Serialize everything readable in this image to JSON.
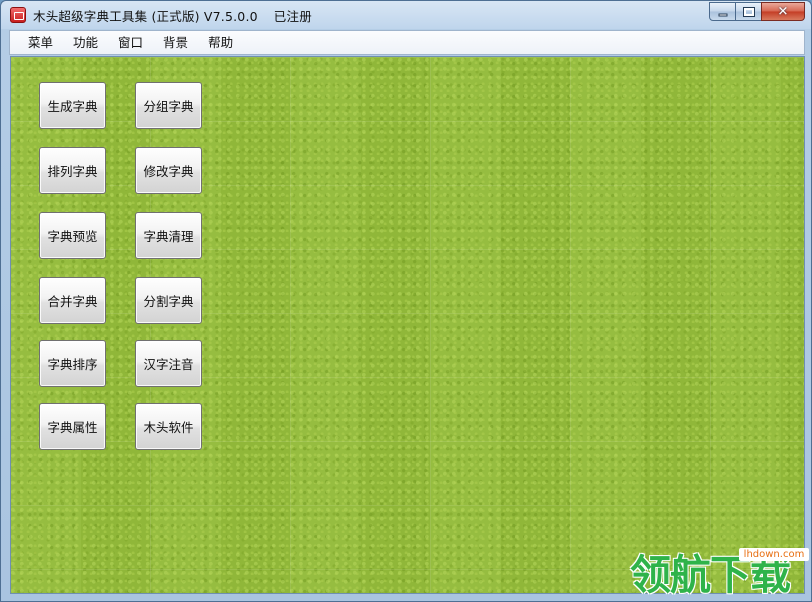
{
  "window": {
    "title": "木头超级字典工具集 (正式版) V7.5.0.0",
    "registration": "已注册"
  },
  "menu": [
    "菜单",
    "功能",
    "窗口",
    "背景",
    "帮助"
  ],
  "tools": {
    "generate_dict": "生成字典",
    "group_dict": "分组字典",
    "arrange_dict": "排列字典",
    "modify_dict": "修改字典",
    "preview_dict": "字典预览",
    "clean_dict": "字典清理",
    "merge_dict": "合并字典",
    "split_dict": "分割字典",
    "sort_dict": "字典排序",
    "pinyin": "汉字注音",
    "dict_properties": "字典属性",
    "mutou_software": "木头软件"
  },
  "watermark": {
    "url": "lhdown.com",
    "brand": "领航下载"
  },
  "colors": {
    "background_green": "#93bb3a",
    "watermark_green": "#2fb34a",
    "watermark_orange": "#e86f12"
  }
}
